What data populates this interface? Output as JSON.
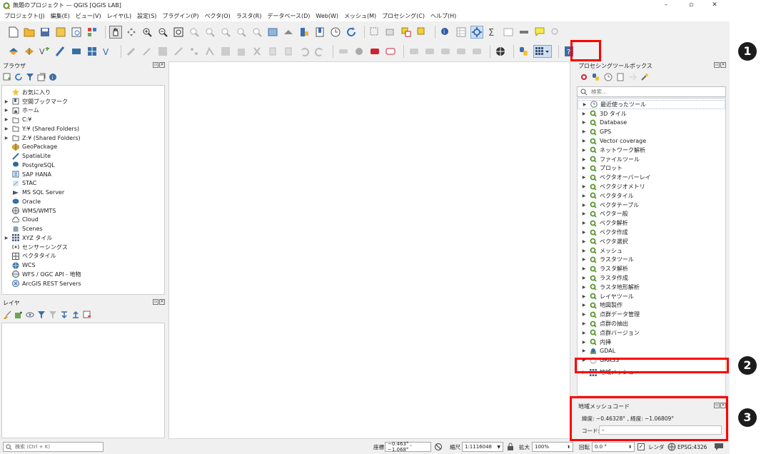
{
  "window": {
    "title": "無題のプロジェクト — QGIS [QGIS LAB]",
    "controls": [
      "–",
      "▫",
      "✕"
    ]
  },
  "menu": [
    "プロジェクト(J)",
    "編集(E)",
    "ビュー(V)",
    "レイヤ(L)",
    "設定(S)",
    "プラグイン(P)",
    "ベクタ(O)",
    "ラスタ(R)",
    "データベース(D)",
    "Web(W)",
    "メッシュ(M)",
    "プロセシング(C)",
    "ヘルプ(H)"
  ],
  "browser": {
    "title": "ブラウザ",
    "items": [
      {
        "label": "お気に入り",
        "icon": "star-icon",
        "expand": false
      },
      {
        "label": "空間ブックマーク",
        "icon": "bookmark-icon",
        "expand": true
      },
      {
        "label": "ホーム",
        "icon": "home-icon",
        "expand": true
      },
      {
        "label": "C:¥",
        "icon": "folder-icon",
        "expand": true
      },
      {
        "label": "Y:¥ (Shared Folders)",
        "icon": "folder-icon",
        "expand": true
      },
      {
        "label": "Z:¥ (Shared Folders)",
        "icon": "folder-icon",
        "expand": true
      },
      {
        "label": "GeoPackage",
        "icon": "geopackage-icon",
        "expand": false
      },
      {
        "label": "SpatiaLite",
        "icon": "spatialite-icon",
        "expand": false
      },
      {
        "label": "PostgreSQL",
        "icon": "postgresql-icon",
        "expand": false
      },
      {
        "label": "SAP HANA",
        "icon": "saphana-icon",
        "expand": false
      },
      {
        "label": "STAC",
        "icon": "stac-icon",
        "expand": false
      },
      {
        "label": "MS SQL Server",
        "icon": "mssql-icon",
        "expand": false
      },
      {
        "label": "Oracle",
        "icon": "oracle-icon",
        "expand": false
      },
      {
        "label": "WMS/WMTS",
        "icon": "wms-icon",
        "expand": false
      },
      {
        "label": "Cloud",
        "icon": "cloud-icon",
        "expand": false
      },
      {
        "label": "Scenes",
        "icon": "scenes-icon",
        "expand": false
      },
      {
        "label": "XYZ タイル",
        "icon": "xyz-tiles-icon",
        "expand": true
      },
      {
        "label": "センサーシングス",
        "icon": "sensor-icon",
        "expand": false
      },
      {
        "label": "ベクタタイル",
        "icon": "vector-tiles-icon",
        "expand": false
      },
      {
        "label": "WCS",
        "icon": "wcs-icon",
        "expand": false
      },
      {
        "label": "WFS / OGC API - 地物",
        "icon": "wfs-icon",
        "expand": false
      },
      {
        "label": "ArcGIS REST Servers",
        "icon": "arcgis-icon",
        "expand": false
      }
    ]
  },
  "layers": {
    "title": "レイヤ"
  },
  "toolbox": {
    "title": "プロセシングツールボックス",
    "search_placeholder": "検索...",
    "items": [
      {
        "label": "最近使ったツール",
        "icon": "clock-icon"
      },
      {
        "label": "3D タイル",
        "icon": "qgis-icon"
      },
      {
        "label": "Database",
        "icon": "qgis-icon"
      },
      {
        "label": "GPS",
        "icon": "qgis-icon"
      },
      {
        "label": "Vector coverage",
        "icon": "qgis-icon"
      },
      {
        "label": "ネットワーク解析",
        "icon": "qgis-icon"
      },
      {
        "label": "ファイルツール",
        "icon": "qgis-icon"
      },
      {
        "label": "プロット",
        "icon": "qgis-icon"
      },
      {
        "label": "ベクタオーバーレイ",
        "icon": "qgis-icon"
      },
      {
        "label": "ベクタジオメトリ",
        "icon": "qgis-icon"
      },
      {
        "label": "ベクタタイル",
        "icon": "qgis-icon"
      },
      {
        "label": "ベクタテーブル",
        "icon": "qgis-icon"
      },
      {
        "label": "ベクター般",
        "icon": "qgis-icon"
      },
      {
        "label": "ベクタ解析",
        "icon": "qgis-icon"
      },
      {
        "label": "ベクタ作成",
        "icon": "qgis-icon"
      },
      {
        "label": "ベクタ選択",
        "icon": "qgis-icon"
      },
      {
        "label": "メッシュ",
        "icon": "qgis-icon"
      },
      {
        "label": "ラスタツール",
        "icon": "qgis-icon"
      },
      {
        "label": "ラスタ解析",
        "icon": "qgis-icon"
      },
      {
        "label": "ラスタ作成",
        "icon": "qgis-icon"
      },
      {
        "label": "ラスタ地形解析",
        "icon": "qgis-icon"
      },
      {
        "label": "レイヤツール",
        "icon": "qgis-icon"
      },
      {
        "label": "地図製作",
        "icon": "qgis-icon"
      },
      {
        "label": "点群データ管理",
        "icon": "qgis-icon"
      },
      {
        "label": "点群の抽出",
        "icon": "qgis-icon"
      },
      {
        "label": "点群バージョン",
        "icon": "qgis-icon"
      },
      {
        "label": "内挿",
        "icon": "qgis-icon"
      },
      {
        "label": "GDAL",
        "icon": "gdal-icon"
      },
      {
        "label": "GRASS",
        "icon": "grass-icon"
      }
    ],
    "mesh_item": "地域メッシュ"
  },
  "mesh_code_panel": {
    "title": "地域メッシュコード",
    "coords": "緯度: −0.46328° , 経度: −1.06809°",
    "code_label": "コード:",
    "code_value": "–"
  },
  "status": {
    "search_placeholder": "検索 (Ctrl + K)",
    "coord_label": "座標",
    "coord_value": "−0.463° , −1.068°",
    "scale_label": "縮尺",
    "scale_value": "1:1116048",
    "magnifier_label": "拡大",
    "magnifier_value": "100%",
    "rotation_label": "回転",
    "rotation_value": "0.0 °",
    "render_label": "レンダ",
    "crs": "EPSG:4326"
  },
  "callouts": [
    "❶",
    "❷",
    "❸"
  ],
  "colors": {
    "highlight": "#ff0000",
    "qgis_green": "#589632"
  }
}
